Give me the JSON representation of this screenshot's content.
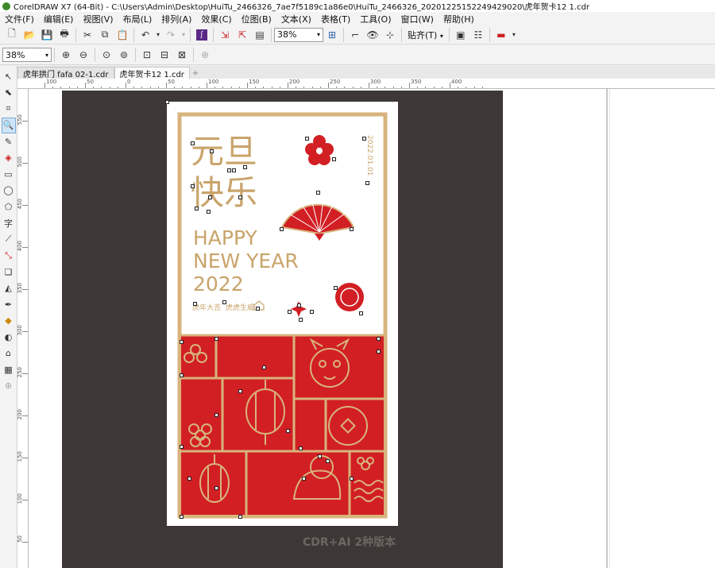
{
  "window": {
    "title": "CorelDRAW X7 (64-Bit) - C:\\Users\\Admin\\Desktop\\HuiTu_2466326_7ae7f5189c1a86e0\\HuiTu_2466326_20201225152249429020\\虎年贺卡12 1.cdr"
  },
  "menu": [
    "文件(F)",
    "编辑(E)",
    "视图(V)",
    "布局(L)",
    "排列(A)",
    "效果(C)",
    "位图(B)",
    "文本(X)",
    "表格(T)",
    "工具(O)",
    "窗口(W)",
    "帮助(H)"
  ],
  "toolbar": {
    "zoom_value": "38%",
    "snap_label": "贴齐(T)"
  },
  "property_bar": {
    "zoom_value": "38%"
  },
  "tabs": [
    {
      "label": "虎年拱门 fafa 02-1.cdr",
      "active": false
    },
    {
      "label": "虎年贺卡12 1.cdr",
      "active": true
    }
  ],
  "ruler": {
    "h_labels": [
      "100",
      "50",
      "0",
      "50",
      "100",
      "150",
      "200",
      "250",
      "300",
      "350",
      "400"
    ],
    "v_labels": [
      "550",
      "500",
      "450",
      "400",
      "350",
      "300",
      "250",
      "200",
      "150",
      "100",
      "50"
    ]
  },
  "card": {
    "title_cn_1": "元旦",
    "title_cn_2": "快乐",
    "english_lines": [
      "HAPPY",
      "NEW YEAR",
      "2022"
    ],
    "vertical_date": "2022.01.01",
    "small_cn_left": "虎年大吉",
    "small_cn_right": "虎虎生威"
  },
  "watermark": "CDR+AI 2种版本",
  "colors": {
    "red": "#d21f24",
    "gold": "#d8b47d",
    "frame_gold": "#caa36b",
    "workspace": "#3d3836"
  }
}
